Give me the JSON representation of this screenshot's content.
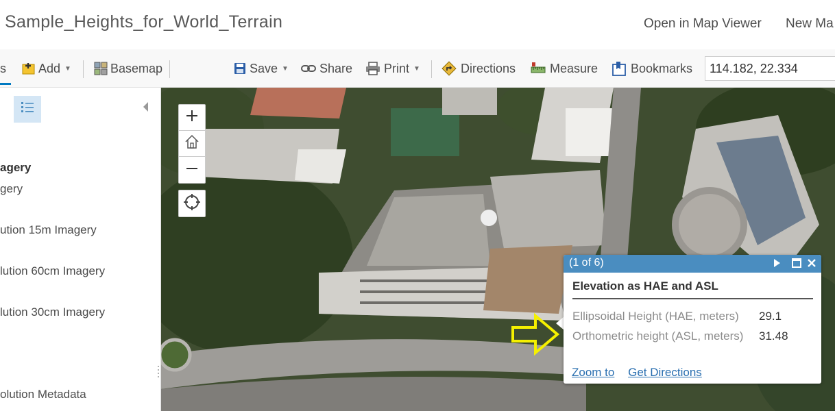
{
  "header": {
    "title": "Sample_Heights_for_World_Terrain",
    "open_in_map_viewer": "Open in Map Viewer",
    "new_map": "New Ma"
  },
  "toolbar": {
    "partial_tab": "s",
    "add_label": "Add",
    "basemap_label": "Basemap",
    "save_label": "Save",
    "share_label": "Share",
    "print_label": "Print",
    "directions_label": "Directions",
    "measure_label": "Measure",
    "bookmarks_label": "Bookmarks",
    "search_value": "114.182, 22.334"
  },
  "left_pane": {
    "layers": [
      {
        "label": "agery",
        "bold": true
      },
      {
        "label": "gery",
        "bold": false
      },
      {
        "label": "ution 15m Imagery",
        "bold": false
      },
      {
        "label": "lution 60cm Imagery",
        "bold": false
      },
      {
        "label": "lution 30cm Imagery",
        "bold": false
      },
      {
        "label": "olution Metadata",
        "bold": false
      }
    ]
  },
  "popup": {
    "counter": "(1 of 6)",
    "title": "Elevation as HAE and ASL",
    "rows": [
      {
        "label": "Ellipsoidal Height (HAE, meters)",
        "value": "29.1"
      },
      {
        "label": "Orthometric height (ASL, meters)",
        "value": "31.48"
      }
    ],
    "zoom_to": "Zoom to",
    "get_directions": "Get Directions"
  },
  "colors": {
    "accent": "#0079c1",
    "popup_header": "#4a8dc0",
    "link": "#2a6fb0",
    "annotation_arrow": "#f5f000"
  }
}
